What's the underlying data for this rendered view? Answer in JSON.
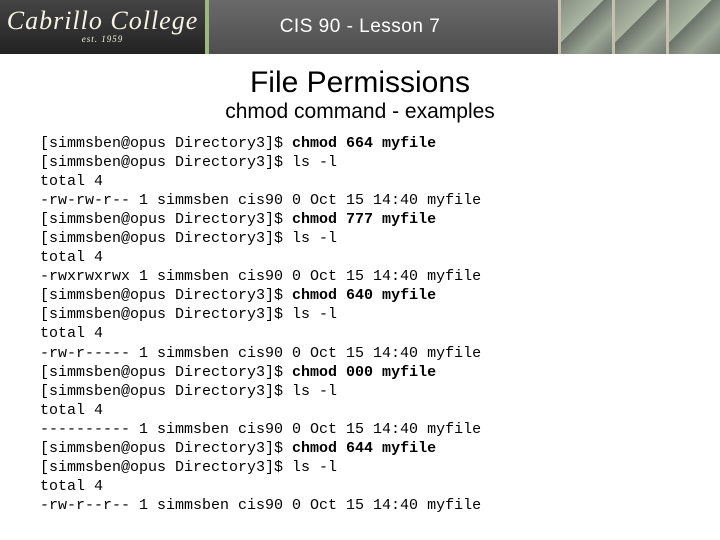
{
  "header": {
    "logo_line1": "Cabrillo",
    "logo_line2": "College",
    "logo_est": "est. 1959",
    "lesson": "CIS 90 - Lesson 7"
  },
  "page": {
    "title": "File Permissions",
    "subtitle": "chmod command - examples"
  },
  "terminal": {
    "prompt": "[simmsben@opus Directory3]$ ",
    "ls_cmd": "ls -l",
    "total_line": "total 4",
    "stat_prefix": " 1 simmsben cis90 0 Oct 15 14:40 myfile",
    "blocks": [
      {
        "chmod": "chmod 664 myfile",
        "perm": "-rw-rw-r--"
      },
      {
        "chmod": "chmod 777 myfile",
        "perm": "-rwxrwxrwx"
      },
      {
        "chmod": "chmod 640 myfile",
        "perm": "-rw-r-----"
      },
      {
        "chmod": "chmod 000 myfile",
        "perm": "----------"
      },
      {
        "chmod": "chmod 644 myfile",
        "perm": "-rw-r--r--"
      }
    ]
  }
}
